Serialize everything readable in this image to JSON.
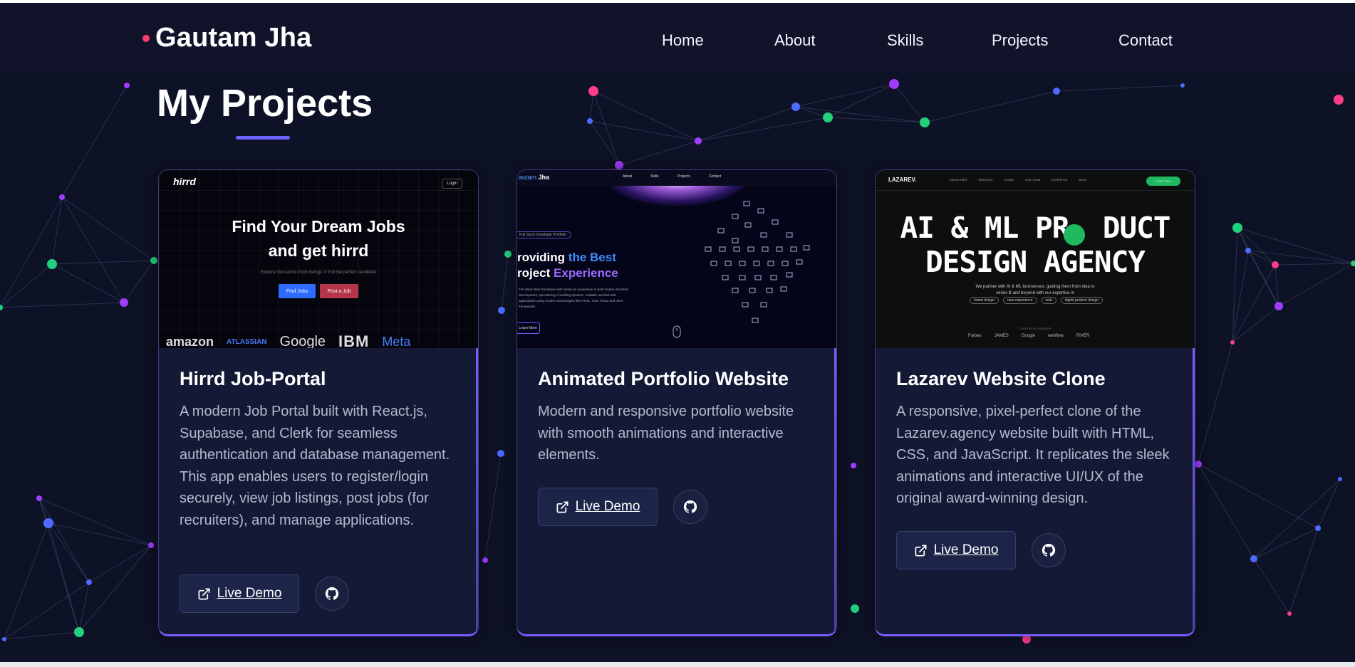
{
  "brand": {
    "name": "Gautam Jha",
    "dot_color": "#ff3d68"
  },
  "nav": [
    "Home",
    "About",
    "Skills",
    "Projects",
    "Contact"
  ],
  "section": {
    "title": "My Projects",
    "accent": "#6c63ff"
  },
  "projects": [
    {
      "title": "Hirrd Job-Portal",
      "description": "A modern Job Portal built with React.js, Supabase, and Clerk for seamless authentication and database management. This app enables users to register/login securely, view job listings, post jobs (for recruiters), and manage applications.",
      "demo_label": "Live Demo",
      "github_icon": "github-icon",
      "thumbnail": {
        "logo": "hirrd",
        "login": "Login",
        "headline1": "Find Your Dream Jobs",
        "headline2": "and get hirrd",
        "sub": "Explore thousands of job listings or find the perfect candidate",
        "btn1": "Find Jobs",
        "btn2": "Post a Job",
        "brands": [
          "amazon",
          "ATLASSIAN",
          "Google",
          "IBM",
          "Meta"
        ]
      }
    },
    {
      "title": "Animated Portfolio Website",
      "description": "Modern and responsive portfolio website with smooth animations and interactive elements.",
      "demo_label": "Live Demo",
      "github_icon": "github-icon",
      "thumbnail": {
        "logo_a": "autam",
        "logo_b": " Jha",
        "links": [
          "About",
          "Skills",
          "Projects",
          "Contact"
        ],
        "pill": "Full Stack Developer Portfolio",
        "h1a": "roviding ",
        "h1b": "the Best",
        "h2a": "roject ",
        "h2b": "Experience",
        "para": "Full Stack Web Developer with hands-on experience in both modern frontend development, specializing in building dynamic, scalable and fast web applications using modern technologies like HTML, CSS, React and other frameworks",
        "btn": "Learn More"
      }
    },
    {
      "title": "Lazarev Website Clone",
      "description": "A responsive, pixel-perfect clone of the Lazarev.agency website built with HTML, CSS, and JavaScript. It replicates the sleek animations and interactive UI/UX of the original award-winning design.",
      "demo_label": "Live Demo",
      "github_icon": "github-icon",
      "thumbnail": {
        "logo": "LAZAREV.",
        "links": [
          "INDUSTRIES",
          "SERVICES",
          "CASES",
          "OUR TEAM",
          "EXPERTISE",
          "BLOG"
        ],
        "cta": "LET'S TALK",
        "h1": "AI & ML PR  DUCT",
        "h2": "DESIGN AGENCY",
        "sub1": "We partner with AI & ML businesses, guiding them from idea to",
        "sub2": "series B and beyond with our expertise in",
        "tags": [
          "brand design",
          "user experience",
          "web",
          "digital product design"
        ],
        "trust": "TRUSTED BY LEADERS",
        "brands": [
          "Forbes",
          "JAMES",
          "Google",
          "webflow",
          "RIVER"
        ]
      }
    }
  ]
}
